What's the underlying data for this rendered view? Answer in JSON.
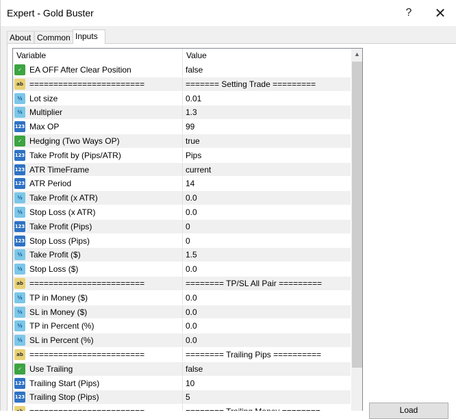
{
  "window": {
    "title": "Expert - Gold Buster",
    "help": "?",
    "close": "✕"
  },
  "tabs": [
    {
      "label": "About"
    },
    {
      "label": "Common"
    },
    {
      "label": "Inputs"
    }
  ],
  "grid": {
    "headers": {
      "variable": "Variable",
      "value": "Value"
    },
    "rows": [
      {
        "type": "bool",
        "variable": "EA OFF After Clear Position",
        "value": "false"
      },
      {
        "type": "str",
        "variable": "========================",
        "value": "======= Setting Trade ========="
      },
      {
        "type": "dbl",
        "variable": "Lot size",
        "value": "0.01"
      },
      {
        "type": "dbl",
        "variable": "Multiplier",
        "value": "1.3"
      },
      {
        "type": "int",
        "variable": "Max OP",
        "value": "99"
      },
      {
        "type": "bool",
        "variable": "Hedging (Two Ways OP)",
        "value": "true"
      },
      {
        "type": "int",
        "variable": "Take Profit by (Pips/ATR)",
        "value": "Pips"
      },
      {
        "type": "int",
        "variable": "ATR TimeFrame",
        "value": "current"
      },
      {
        "type": "int",
        "variable": "ATR Period",
        "value": "14"
      },
      {
        "type": "dbl",
        "variable": "Take Profit (x ATR)",
        "value": "0.0"
      },
      {
        "type": "dbl",
        "variable": "Stop Loss (x ATR)",
        "value": "0.0"
      },
      {
        "type": "int",
        "variable": "Take Profit (Pips)",
        "value": "0"
      },
      {
        "type": "int",
        "variable": "Stop Loss (Pips)",
        "value": "0"
      },
      {
        "type": "dbl",
        "variable": "Take Profit ($)",
        "value": "1.5"
      },
      {
        "type": "dbl",
        "variable": "Stop Loss ($)",
        "value": "0.0"
      },
      {
        "type": "str",
        "variable": "========================",
        "value": "======== TP/SL All Pair ========="
      },
      {
        "type": "dbl",
        "variable": "TP in Money ($)",
        "value": "0.0"
      },
      {
        "type": "dbl",
        "variable": "SL in Money ($)",
        "value": "0.0"
      },
      {
        "type": "dbl",
        "variable": "TP in Percent (%)",
        "value": "0.0"
      },
      {
        "type": "dbl",
        "variable": "SL in Percent (%)",
        "value": "0.0"
      },
      {
        "type": "str",
        "variable": "========================",
        "value": "======== Trailing Pips =========="
      },
      {
        "type": "bool",
        "variable": "Use Trailing",
        "value": "false"
      },
      {
        "type": "int",
        "variable": "Trailing Start (Pips)",
        "value": "10"
      },
      {
        "type": "int",
        "variable": "Trailing Stop (Pips)",
        "value": "5"
      },
      {
        "type": "str",
        "variable": "========================",
        "value": "======== Trailing Money ========"
      }
    ]
  },
  "icons": {
    "bool": {
      "name": "boolean-icon",
      "glyph": "✓"
    },
    "dbl": {
      "name": "double-icon",
      "glyph": "½"
    },
    "int": {
      "name": "integer-icon",
      "glyph": "123"
    },
    "str": {
      "name": "string-icon",
      "glyph": "ab"
    }
  },
  "scrollbar": {
    "up_arrow": "▲"
  },
  "load_button": {
    "label": "Load"
  }
}
